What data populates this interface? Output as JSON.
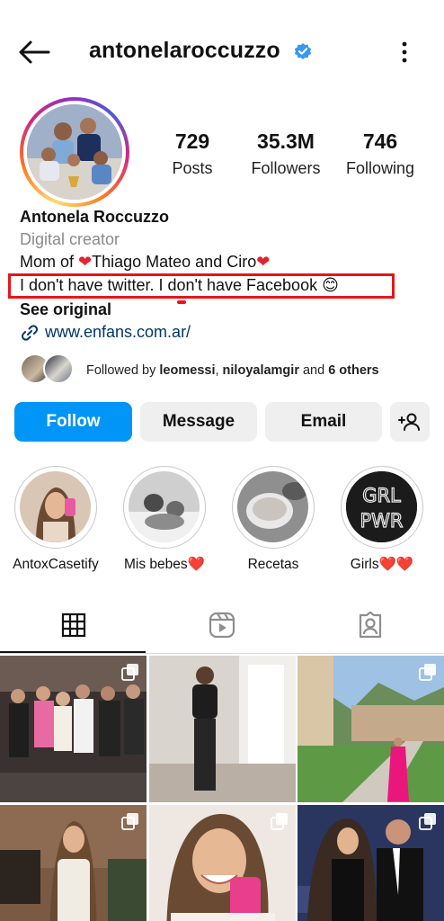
{
  "header": {
    "username": "antonelaroccuzzo",
    "verified": true,
    "back_icon": "arrow-left-icon",
    "menu_icon": "more-vertical-icon"
  },
  "stats": {
    "posts": {
      "value": "729",
      "label": "Posts"
    },
    "followers": {
      "value": "35.3M",
      "label": "Followers"
    },
    "following": {
      "value": "746",
      "label": "Following"
    }
  },
  "bio": {
    "name": "Antonela Roccuzzo",
    "category": "Digital creator",
    "line1_prefix": "Mom of ",
    "line1_kids": "Thiago Mateo and Ciro",
    "line2": "I don't have twitter. I don't have Facebook 😊",
    "see_original": "See original",
    "link": "www.enfans.com.ar/"
  },
  "followed_by": {
    "prefix": "Followed by ",
    "user1": "leomessi",
    "sep": ", ",
    "user2": "niloyalamgir",
    "mid": " and ",
    "others": "6 others"
  },
  "buttons": {
    "follow": "Follow",
    "message": "Message",
    "email": "Email",
    "add_icon": "add-person-icon"
  },
  "highlights": [
    {
      "label": "AntoxCasetify"
    },
    {
      "label": "Mis bebes❤️"
    },
    {
      "label": "Recetas"
    },
    {
      "label": "Girls❤️❤️"
    }
  ],
  "highlight_text": {
    "grl": "GRL",
    "pwr": "PWR"
  },
  "tabs": [
    {
      "icon": "grid-icon",
      "active": true
    },
    {
      "icon": "reels-icon",
      "active": false
    },
    {
      "icon": "tagged-icon",
      "active": false
    }
  ],
  "colors": {
    "accent": "#0095f6",
    "highlight_box": "#e8141b",
    "link": "#00376b"
  }
}
